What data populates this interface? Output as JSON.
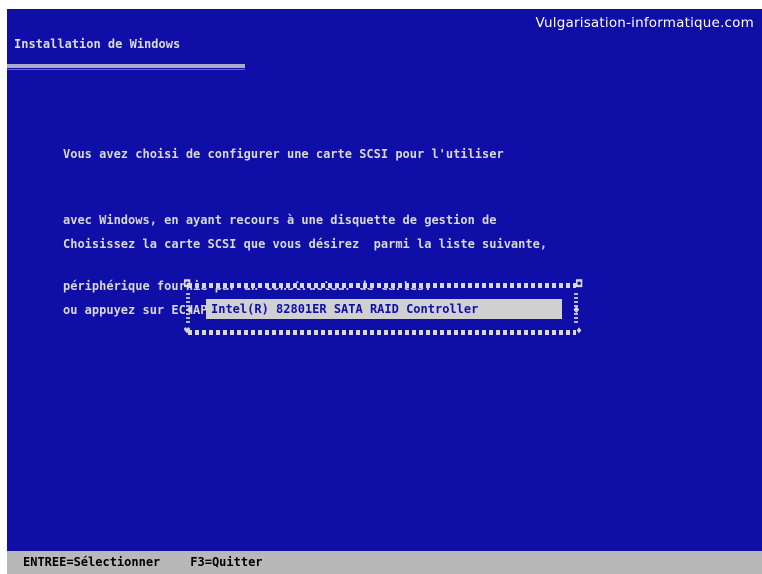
{
  "watermark": "Vulgarisation-informatique.com",
  "window": {
    "title": "Installation de Windows"
  },
  "instructions": {
    "paragraph1": [
      "Vous avez choisi de configurer une carte SCSI pour l'utiliser",
      "avec Windows, en ayant recours à une disquette de gestion de",
      "périphérique fournie par un constructeur de cartes."
    ],
    "paragraph2": [
      "Choisissez la carte SCSI que vous désirez  parmi la liste suivante,",
      "ou appuyez sur ECHAP pour revenir à l'écran précédent."
    ]
  },
  "device_list": {
    "items": [
      {
        "label": "Intel(R) 82801ER SATA RAID Controller",
        "selected": true
      }
    ],
    "scroll_up_glyph": "♦",
    "scroll_down_glyph": "♦"
  },
  "status_bar": {
    "select_action": "ENTREE=Sélectionner",
    "quit_action": "F3=Quitter"
  },
  "colors": {
    "background": "#0f0fa8",
    "text": "#d8d8d8",
    "selection_bg": "#d0d0d0",
    "status_bg": "#b8b8b8"
  }
}
